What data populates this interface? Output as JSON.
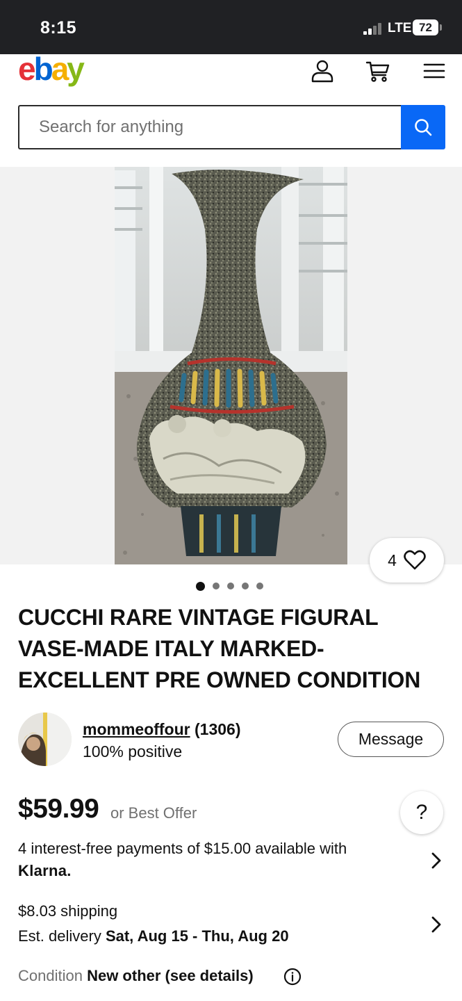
{
  "status_bar": {
    "time": "8:15",
    "network": "LTE",
    "battery": "72"
  },
  "header": {
    "logo": {
      "e": "e",
      "b": "b",
      "a": "a",
      "y": "y"
    },
    "icons": [
      "user-icon",
      "cart-icon",
      "menu-icon"
    ]
  },
  "search": {
    "placeholder": "Search for anything",
    "value": ""
  },
  "gallery": {
    "watchers": "4",
    "image_count": 5,
    "active_index": 0
  },
  "listing": {
    "title": "CUCCHI RARE VINTAGE FIGURAL VASE-MADE ITALY MARKED-EXCELLENT PRE OWNED CONDITION"
  },
  "seller": {
    "name": "mommeoffour",
    "feedback": "(1306)",
    "positive": "100% positive",
    "message_label": "Message"
  },
  "price": {
    "amount": "$59.99",
    "best_offer": "or Best Offer",
    "help": "?"
  },
  "klarna": {
    "line": "4 interest-free payments of $15.00 available with",
    "brand": "Klarna."
  },
  "shipping": {
    "cost": "$8.03 shipping",
    "est_prefix": "Est. delivery ",
    "est_dates": "Sat, Aug 15 - Thu, Aug 20"
  },
  "condition": {
    "label": "Condition ",
    "value": "New other (see details)"
  },
  "colors": {
    "ebay_red": "#e53238",
    "ebay_blue": "#0064d2",
    "ebay_yellow": "#f5af02",
    "ebay_green": "#86b817",
    "search_button": "#0968f6",
    "status_bar": "#202124"
  }
}
